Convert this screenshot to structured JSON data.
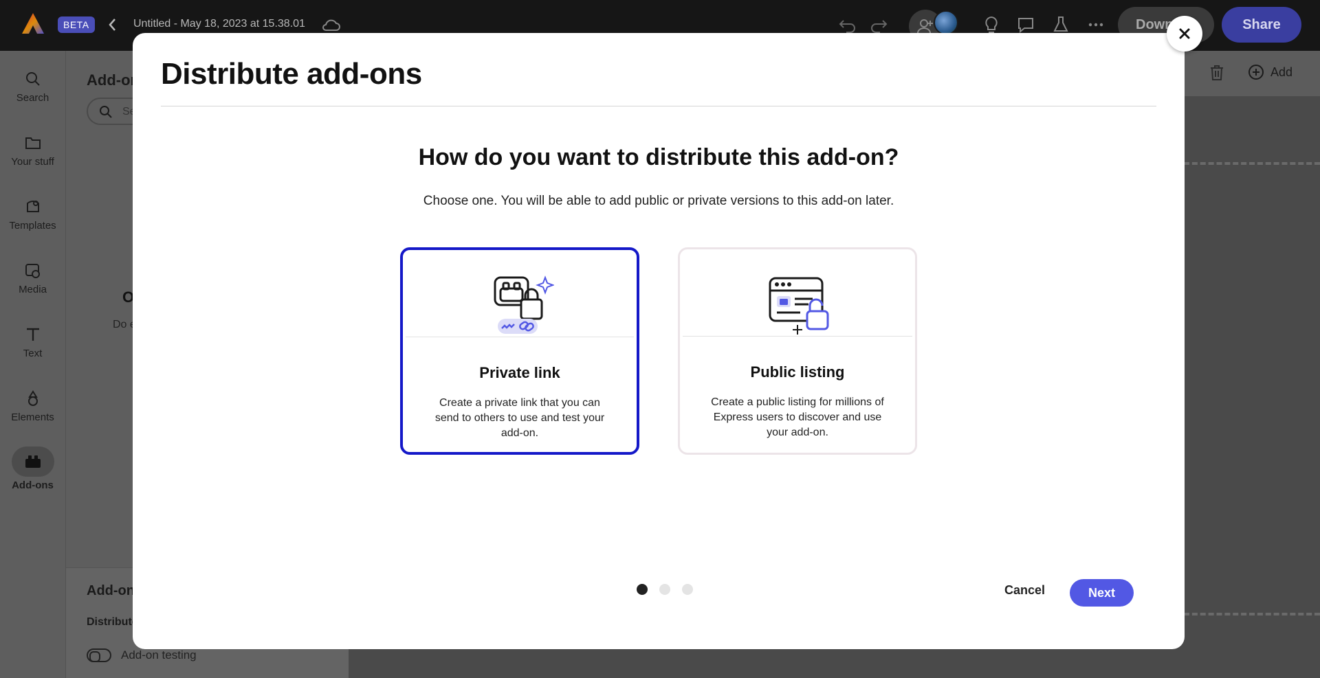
{
  "header": {
    "beta_label": "BETA",
    "doc_title": "Untitled - May 18, 2023 at 15.38.01",
    "download_label": "Down",
    "share_label": "Share"
  },
  "left_rail": {
    "items": [
      {
        "label": "Search",
        "icon": "search-icon"
      },
      {
        "label": "Your stuff",
        "icon": "folder-icon"
      },
      {
        "label": "Templates",
        "icon": "templates-icon"
      },
      {
        "label": "Media",
        "icon": "media-icon"
      },
      {
        "label": "Text",
        "icon": "text-icon"
      },
      {
        "label": "Elements",
        "icon": "elements-icon"
      },
      {
        "label": "Add-ons",
        "icon": "addons-icon"
      }
    ]
  },
  "panel": {
    "title": "Add-on",
    "search_placeholder": "Se",
    "empty_title": "O",
    "empty_desc": "Do e",
    "bottom_title": "Add-on",
    "bottom_subtitle": "Distribute",
    "toggle_label": "Add-on testing"
  },
  "canvas_toolbar": {
    "add_label": "Add"
  },
  "modal": {
    "title": "Distribute add-ons",
    "question": "How do you want to distribute this add-on?",
    "subtitle": "Choose one. You will be able to add public or private versions to this add-on later.",
    "options": [
      {
        "title": "Private link",
        "description": "Create a private link that you can send to others to use and test your add-on.",
        "selected": true
      },
      {
        "title": "Public listing",
        "description": "Create a public listing for millions of Express users to discover and use your add-on.",
        "selected": false
      }
    ],
    "pager": {
      "current": 1,
      "total": 3
    },
    "cancel_label": "Cancel",
    "next_label": "Next"
  },
  "colors": {
    "accent": "#5258e4",
    "selected_border": "#1418c8",
    "beta_badge": "#4a4eb8"
  }
}
